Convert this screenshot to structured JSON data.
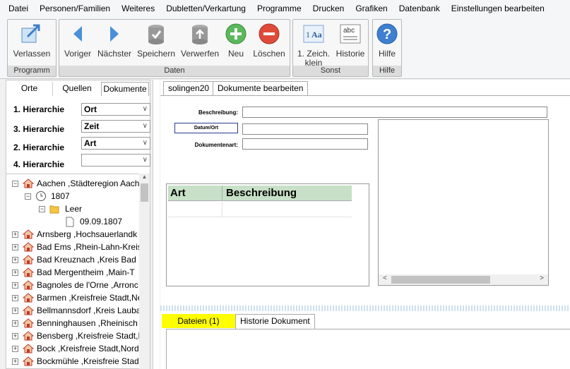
{
  "menu": [
    "Datei",
    "Personen/Familien",
    "Weiteres",
    "Dubletten/Verkartung",
    "Programme",
    "Drucken",
    "Grafiken",
    "Datenbank",
    "Einstellungen bearbeiten"
  ],
  "ribbon": {
    "programm": {
      "label": "Programm",
      "verlassen": "Verlassen"
    },
    "daten": {
      "label": "Daten",
      "voriger": "Voriger",
      "naechster": "Nächster",
      "speichern": "Speichern",
      "verwerfen": "Verwerfen",
      "neu": "Neu",
      "loeschen": "Löschen"
    },
    "sonst": {
      "label": "Sonst",
      "zeich": "1. Zeich.",
      "klein": "klein",
      "historie": "Historie"
    },
    "hilfe": {
      "label": "Hilfe",
      "hilfe": "Hilfe"
    }
  },
  "left": {
    "tabs": [
      "Orte",
      "Quellen",
      "Dokumente"
    ],
    "h1": {
      "label": "1. Hierarchie",
      "value": "Ort"
    },
    "h3": {
      "label": "3. Hierarchie",
      "value": "Zeit"
    },
    "h2": {
      "label": "2. Hierarchie",
      "value": "Art"
    },
    "h4": {
      "label": "4. Hierarchie",
      "value": ""
    },
    "tree": {
      "root": "Aachen ,Städteregion Aach",
      "year": "1807",
      "leer": "Leer",
      "date": "09.09.1807",
      "items": [
        "Arnsberg ,Hochsauerlandk",
        "Bad Ems ,Rhein-Lahn-Kreis",
        "Bad Kreuznach ,Kreis Bad K",
        "Bad Mergentheim ,Main-T",
        "Bagnoles de l'Orne ,Arronc",
        "Barmen ,Kreisfreie Stadt,Ne",
        "Bellmannsdorf ,Kreis Lauba",
        "Benninghausen ,Rheinisch",
        "Bensberg ,Kreisfreie Stadt,I",
        "Bock ,Kreisfreie Stadt,Nord",
        "Bockmühle ,Kreisfreie Stad"
      ]
    }
  },
  "right": {
    "tabs": [
      "solingen20",
      "Dokumente bearbeiten"
    ],
    "form": {
      "beschreibung": "Beschreibung:",
      "datumort": "Datum/Ort",
      "dokumentenart": "Dokumentenart:"
    },
    "table": {
      "headers": [
        "Art",
        "Beschreibung"
      ]
    },
    "bottomtabs": [
      "Dateien (1)",
      "Historie Dokument"
    ]
  },
  "colors": {
    "accent": "#5a9bd5",
    "tableHeader": "#c7e0c7",
    "highlight": "#ffff00"
  }
}
